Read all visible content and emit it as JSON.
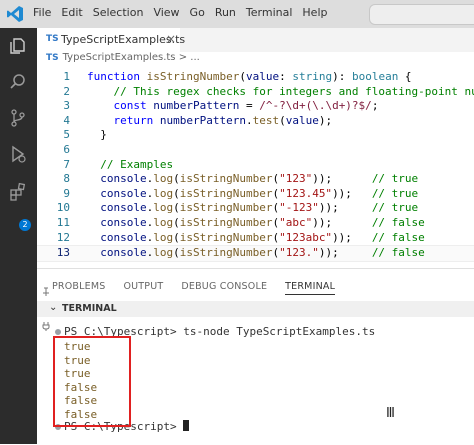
{
  "menu": [
    "File",
    "Edit",
    "Selection",
    "View",
    "Go",
    "Run",
    "Terminal",
    "Help"
  ],
  "activity_icons": [
    "explorer-icon",
    "search-icon",
    "source-control-icon",
    "run-debug-icon",
    "extensions-icon"
  ],
  "extensions_badge": "2",
  "tab": {
    "lang": "TS",
    "filename": "TypeScriptExamples.ts",
    "close": "×"
  },
  "breadcrumb": {
    "lang": "TS",
    "filename": "TypeScriptExamples.ts",
    "trail": "> ..."
  },
  "code_lines": [
    {
      "n": "1",
      "tokens": [
        [
          "kw",
          "function "
        ],
        [
          "fn",
          "isStringNumber"
        ],
        [
          "pl",
          "("
        ],
        [
          "vr",
          "value"
        ],
        [
          "pl",
          ": "
        ],
        [
          "ty",
          "string"
        ],
        [
          "pl",
          "): "
        ],
        [
          "ty",
          "boolean"
        ],
        [
          "pl",
          " {"
        ]
      ]
    },
    {
      "n": "2",
      "tokens": [
        [
          "pl",
          "    "
        ],
        [
          "cm",
          "// This regex checks for integers and floating-point numbers"
        ]
      ]
    },
    {
      "n": "3",
      "tokens": [
        [
          "pl",
          "    "
        ],
        [
          "kw",
          "const "
        ],
        [
          "vr",
          "numberPattern"
        ],
        [
          "pl",
          " = "
        ],
        [
          "rx",
          "/^-?\\d+(\\.\\d+)?$/"
        ],
        [
          "pl",
          ";"
        ]
      ]
    },
    {
      "n": "4",
      "tokens": [
        [
          "pl",
          "    "
        ],
        [
          "kw",
          "return "
        ],
        [
          "vr",
          "numberPattern"
        ],
        [
          "pl",
          "."
        ],
        [
          "fn",
          "test"
        ],
        [
          "pl",
          "("
        ],
        [
          "vr",
          "value"
        ],
        [
          "pl",
          ");"
        ]
      ]
    },
    {
      "n": "5",
      "tokens": [
        [
          "pl",
          "  }"
        ]
      ]
    },
    {
      "n": "6",
      "tokens": []
    },
    {
      "n": "7",
      "tokens": [
        [
          "pl",
          "  "
        ],
        [
          "cm",
          "// Examples"
        ]
      ]
    },
    {
      "n": "8",
      "tokens": [
        [
          "pl",
          "  "
        ],
        [
          "vr",
          "console"
        ],
        [
          "pl",
          "."
        ],
        [
          "fn",
          "log"
        ],
        [
          "pl",
          "("
        ],
        [
          "fn",
          "isStringNumber"
        ],
        [
          "pl",
          "("
        ],
        [
          "str",
          "\"123\""
        ],
        [
          "pl",
          "));      "
        ],
        [
          "cm",
          "// true"
        ]
      ]
    },
    {
      "n": "9",
      "tokens": [
        [
          "pl",
          "  "
        ],
        [
          "vr",
          "console"
        ],
        [
          "pl",
          "."
        ],
        [
          "fn",
          "log"
        ],
        [
          "pl",
          "("
        ],
        [
          "fn",
          "isStringNumber"
        ],
        [
          "pl",
          "("
        ],
        [
          "str",
          "\"123.45\""
        ],
        [
          "pl",
          "));   "
        ],
        [
          "cm",
          "// true"
        ]
      ]
    },
    {
      "n": "10",
      "tokens": [
        [
          "pl",
          "  "
        ],
        [
          "vr",
          "console"
        ],
        [
          "pl",
          "."
        ],
        [
          "fn",
          "log"
        ],
        [
          "pl",
          "("
        ],
        [
          "fn",
          "isStringNumber"
        ],
        [
          "pl",
          "("
        ],
        [
          "str",
          "\"-123\""
        ],
        [
          "pl",
          "));     "
        ],
        [
          "cm",
          "// true"
        ]
      ]
    },
    {
      "n": "11",
      "tokens": [
        [
          "pl",
          "  "
        ],
        [
          "vr",
          "console"
        ],
        [
          "pl",
          "."
        ],
        [
          "fn",
          "log"
        ],
        [
          "pl",
          "("
        ],
        [
          "fn",
          "isStringNumber"
        ],
        [
          "pl",
          "("
        ],
        [
          "str",
          "\"abc\""
        ],
        [
          "pl",
          "));      "
        ],
        [
          "cm",
          "// false"
        ]
      ]
    },
    {
      "n": "12",
      "tokens": [
        [
          "pl",
          "  "
        ],
        [
          "vr",
          "console"
        ],
        [
          "pl",
          "."
        ],
        [
          "fn",
          "log"
        ],
        [
          "pl",
          "("
        ],
        [
          "fn",
          "isStringNumber"
        ],
        [
          "pl",
          "("
        ],
        [
          "str",
          "\"123abc\""
        ],
        [
          "pl",
          "));   "
        ],
        [
          "cm",
          "// false"
        ]
      ]
    },
    {
      "n": "13",
      "tokens": [
        [
          "pl",
          "  "
        ],
        [
          "vr",
          "console"
        ],
        [
          "pl",
          "."
        ],
        [
          "fn",
          "log"
        ],
        [
          "pl",
          "("
        ],
        [
          "fn",
          "isStringNumber"
        ],
        [
          "pl",
          "("
        ],
        [
          "str",
          "\"123.\""
        ],
        [
          "pl",
          "));     "
        ],
        [
          "cm",
          "// false"
        ]
      ]
    }
  ],
  "current_line": "13",
  "panel_tabs": [
    "PROBLEMS",
    "OUTPUT",
    "DEBUG CONSOLE",
    "TERMINAL"
  ],
  "active_panel_tab": "TERMINAL",
  "terminal_section": "TERMINAL",
  "terminal": {
    "prompt": "PS C:\\Typescript>",
    "command": "ts-node TypeScriptExamples.ts",
    "output": [
      "true",
      "true",
      "true",
      "false",
      "false",
      "false"
    ]
  },
  "colors": {
    "accent": "#0078d4",
    "highlight_box": "#e02020",
    "ts_blue": "#3178c6"
  }
}
